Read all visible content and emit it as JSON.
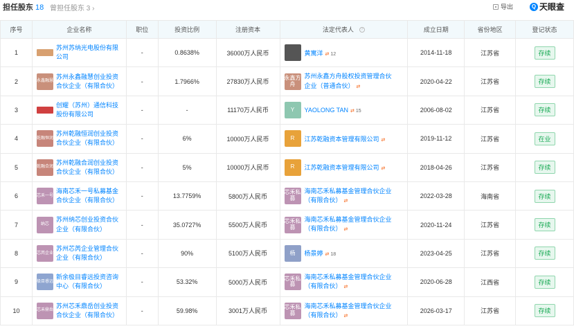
{
  "tabs": {
    "active_label": "担任股东",
    "active_count": "18",
    "inactive_label": "曾担任股东",
    "inactive_count": "3",
    "inactive_chevron": "›"
  },
  "toolbar": {
    "export_label": "导出"
  },
  "brand": {
    "logo_glyph": "Q",
    "name": "天眼查"
  },
  "columns": [
    "序号",
    "企业名称",
    "职位",
    "投资比例",
    "注册资本",
    "法定代表人",
    "成立日期",
    "省份地区",
    "登记状态"
  ],
  "rows": [
    {
      "idx": "1",
      "name": "苏州苏纳光电股份有限公司",
      "logo_text": "",
      "logo_color": "#d8a070",
      "role": "-",
      "ratio": "0.8638%",
      "capital": "36000万人民币",
      "legal": "黄寓洋",
      "legal_logo": "",
      "legal_logo_color": "#555555",
      "legal_tag": "12",
      "date": "2014-11-18",
      "province": "江苏省",
      "status": "存续"
    },
    {
      "idx": "2",
      "name": "苏州永鑫融慧创业投资合伙企业（有限合伙）",
      "logo_text": "永鑫融慧",
      "logo_color": "#c9907b",
      "role": "-",
      "ratio": "1.7966%",
      "capital": "27830万人民币",
      "legal": "苏州永鑫方舟股权投资管理合伙企业（普通合伙）",
      "legal_logo": "永鑫方舟",
      "legal_logo_color": "#c9907b",
      "legal_tag": "",
      "date": "2020-04-22",
      "province": "江苏省",
      "status": "存续"
    },
    {
      "idx": "3",
      "name": "创耀（苏州）通信科技股份有限公司",
      "logo_text": "",
      "logo_color": "#d04040",
      "role": "-",
      "ratio": "-",
      "capital": "11170万人民币",
      "legal": "YAOLONG TAN",
      "legal_logo": "Y",
      "legal_logo_color": "#8ec7b0",
      "legal_tag": "15",
      "date": "2006-08-02",
      "province": "江苏省",
      "status": "存续"
    },
    {
      "idx": "4",
      "name": "苏州乾融恒润创业投资合伙企业（有限合伙）",
      "logo_text": "乾融恒润",
      "logo_color": "#c7857a",
      "role": "-",
      "ratio": "6%",
      "capital": "10000万人民币",
      "legal": "江苏乾融资本管理有限公司",
      "legal_logo": "R",
      "legal_logo_color": "#e8a23a",
      "legal_tag": "",
      "date": "2019-11-12",
      "province": "江苏省",
      "status": "在业"
    },
    {
      "idx": "5",
      "name": "苏州乾融合润创业投资合伙企业（有限合伙）",
      "logo_text": "乾融合润",
      "logo_color": "#c7857a",
      "role": "-",
      "ratio": "5%",
      "capital": "10000万人民币",
      "legal": "江苏乾融资本管理有限公司",
      "legal_logo": "R",
      "legal_logo_color": "#e8a23a",
      "legal_tag": "",
      "date": "2018-04-26",
      "province": "江苏省",
      "status": "存续"
    },
    {
      "idx": "6",
      "name": "海南芯禾一号私募基金合伙企业（有限合伙）",
      "logo_text": "芯禾一号",
      "logo_color": "#bd93b3",
      "role": "-",
      "ratio": "13.7759%",
      "capital": "5800万人民币",
      "legal": "海南芯禾私募基金管理合伙企业（有限合伙）",
      "legal_logo": "芯禾私募",
      "legal_logo_color": "#bd93b3",
      "legal_tag": "",
      "date": "2022-03-28",
      "province": "海南省",
      "status": "存续"
    },
    {
      "idx": "7",
      "name": "苏州纳芯创业投资合伙企业（有限合伙）",
      "logo_text": "纳芯",
      "logo_color": "#bd93b3",
      "role": "-",
      "ratio": "35.0727%",
      "capital": "5500万人民币",
      "legal": "海南芯禾私募基金管理合伙企业（有限合伙）",
      "legal_logo": "芯禾私募",
      "legal_logo_color": "#bd93b3",
      "legal_tag": "",
      "date": "2020-11-24",
      "province": "江苏省",
      "status": "存续"
    },
    {
      "idx": "8",
      "name": "苏州芯芮企业管理合伙企业（有限合伙）",
      "logo_text": "芯芮企业",
      "logo_color": "#bd93b3",
      "role": "-",
      "ratio": "90%",
      "capital": "5100万人民币",
      "legal": "杨景婷",
      "legal_logo": "杨",
      "legal_logo_color": "#8fa0c8",
      "legal_tag": "18",
      "date": "2023-04-25",
      "province": "江苏省",
      "status": "存续"
    },
    {
      "idx": "9",
      "name": "新余极目睿远投资咨询中心（有限合伙）",
      "logo_text": "极目睿远",
      "logo_color": "#8ea5d0",
      "role": "-",
      "ratio": "53.32%",
      "capital": "5000万人民币",
      "legal": "海南芯禾私募基金管理合伙企业（有限合伙）",
      "legal_logo": "芯禾私募",
      "legal_logo_color": "#bd93b3",
      "legal_tag": "",
      "date": "2020-06-28",
      "province": "江西省",
      "status": "存续"
    },
    {
      "idx": "10",
      "name": "苏州芯禾鼎岳创业投资合伙企业（有限合伙）",
      "logo_text": "芯禾鼎岳",
      "logo_color": "#bd93b3",
      "role": "-",
      "ratio": "59.98%",
      "capital": "3001万人民币",
      "legal": "海南芯禾私募基金管理合伙企业（有限合伙）",
      "legal_logo": "芯禾私募",
      "legal_logo_color": "#bd93b3",
      "legal_tag": "",
      "date": "2026-03-17",
      "province": "江苏省",
      "status": "存续"
    }
  ]
}
